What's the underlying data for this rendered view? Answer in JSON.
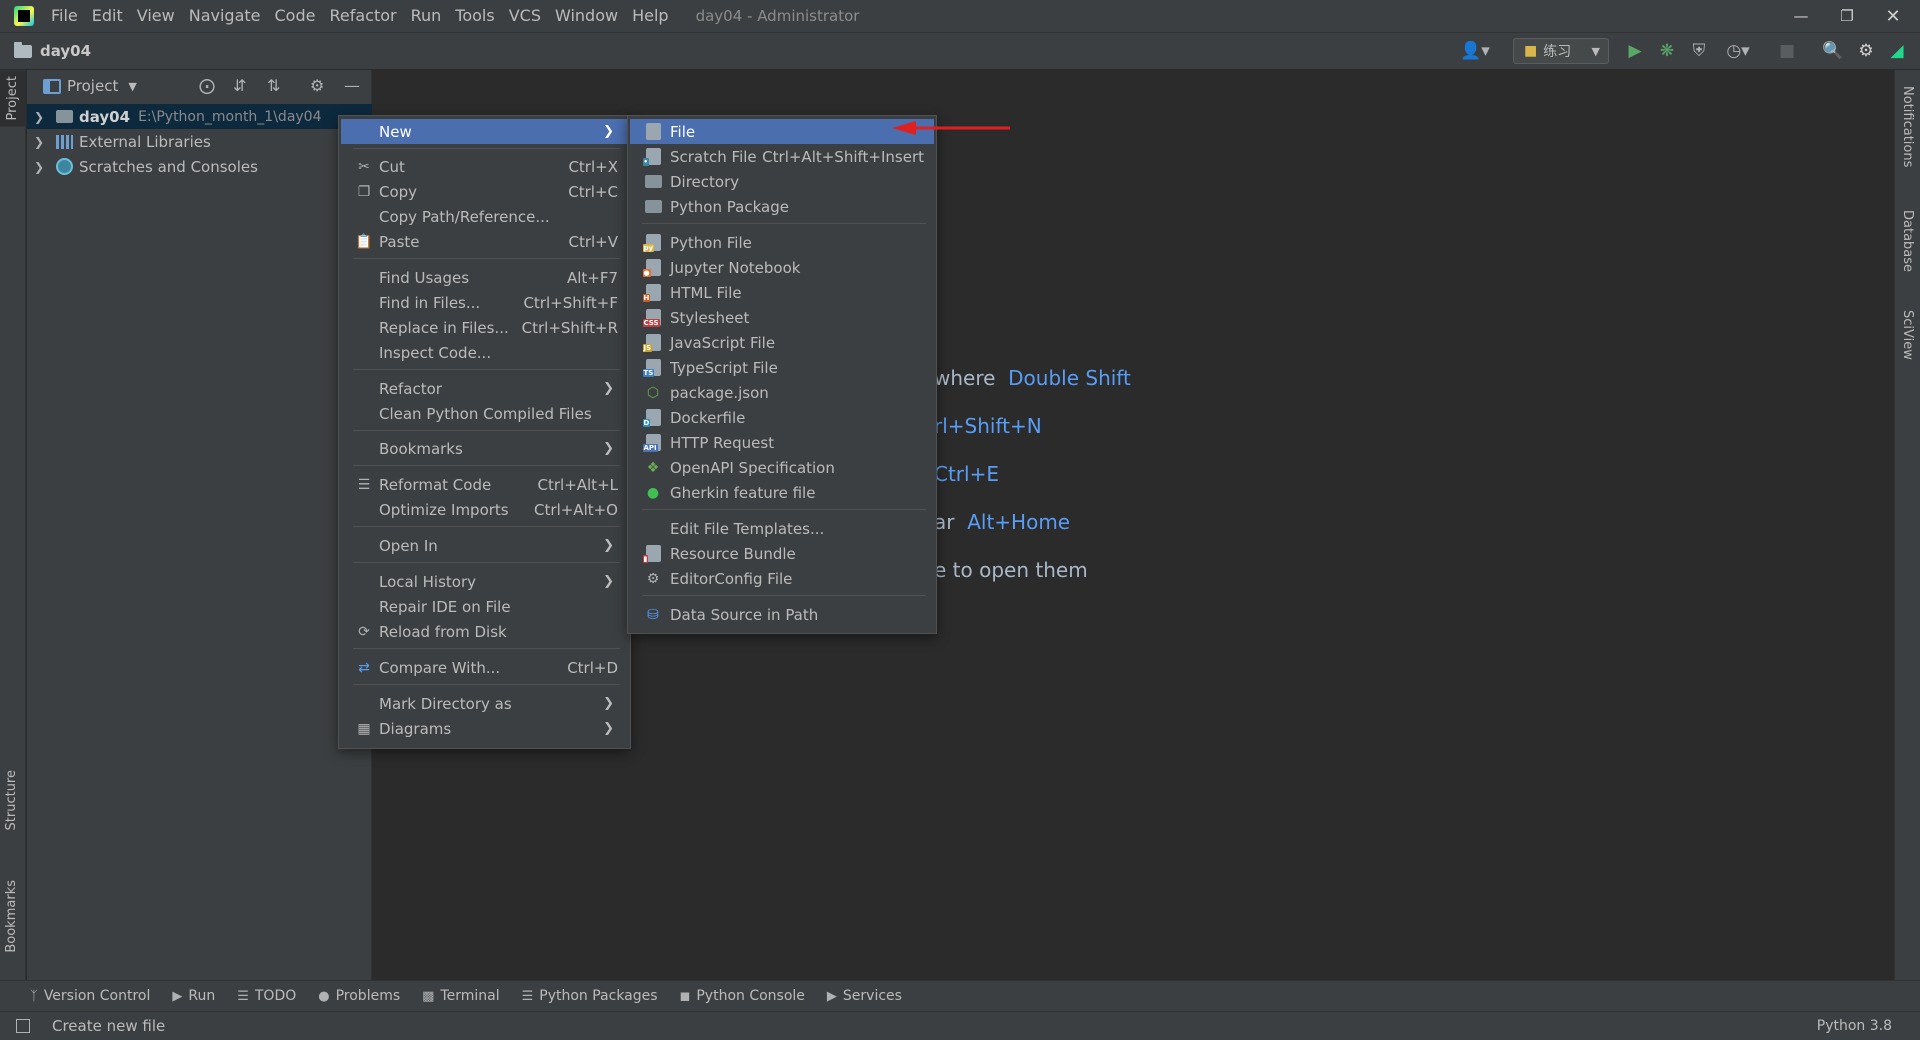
{
  "window": {
    "title": "day04 - Administrator"
  },
  "menu": [
    "File",
    "Edit",
    "View",
    "Navigate",
    "Code",
    "Refactor",
    "Run",
    "Tools",
    "VCS",
    "Window",
    "Help"
  ],
  "navbar": {
    "project_name": "day04",
    "run_config": "练习"
  },
  "left_stripe": {
    "project": "Project",
    "structure": "Structure",
    "bookmarks": "Bookmarks"
  },
  "right_stripe": {
    "notifications": "Notifications",
    "database": "Database",
    "sciview": "SciView"
  },
  "project_panel": {
    "title": "Project",
    "tree": [
      {
        "name": "day04",
        "path": "E:\\Python_month_1\\day04"
      },
      {
        "name": "External Libraries"
      },
      {
        "name": "Scratches and Consoles"
      }
    ]
  },
  "editor_hints": [
    {
      "text": "where",
      "key": "Double Shift"
    },
    {
      "text": "rl+Shift+N"
    },
    {
      "text": "Ctrl+E"
    },
    {
      "text": "ar",
      "key": "Alt+Home"
    },
    {
      "text": "e to open them"
    }
  ],
  "context_menu": {
    "items": [
      {
        "label": "New"
      },
      {
        "label": "Cut",
        "shortcut": "Ctrl+X"
      },
      {
        "label": "Copy",
        "shortcut": "Ctrl+C"
      },
      {
        "label": "Copy Path/Reference..."
      },
      {
        "label": "Paste",
        "shortcut": "Ctrl+V"
      },
      {
        "label": "Find Usages",
        "shortcut": "Alt+F7"
      },
      {
        "label": "Find in Files...",
        "shortcut": "Ctrl+Shift+F"
      },
      {
        "label": "Replace in Files...",
        "shortcut": "Ctrl+Shift+R"
      },
      {
        "label": "Inspect Code..."
      },
      {
        "label": "Refactor"
      },
      {
        "label": "Clean Python Compiled Files"
      },
      {
        "label": "Bookmarks"
      },
      {
        "label": "Reformat Code",
        "shortcut": "Ctrl+Alt+L"
      },
      {
        "label": "Optimize Imports",
        "shortcut": "Ctrl+Alt+O"
      },
      {
        "label": "Open In"
      },
      {
        "label": "Local History"
      },
      {
        "label": "Repair IDE on File"
      },
      {
        "label": "Reload from Disk"
      },
      {
        "label": "Compare With...",
        "shortcut": "Ctrl+D"
      },
      {
        "label": "Mark Directory as"
      },
      {
        "label": "Diagrams"
      }
    ]
  },
  "new_submenu": {
    "items": [
      {
        "label": "File"
      },
      {
        "label": "Scratch File",
        "shortcut": "Ctrl+Alt+Shift+Insert"
      },
      {
        "label": "Directory"
      },
      {
        "label": "Python Package"
      },
      {
        "label": "Python File"
      },
      {
        "label": "Jupyter Notebook"
      },
      {
        "label": "HTML File"
      },
      {
        "label": "Stylesheet"
      },
      {
        "label": "JavaScript File"
      },
      {
        "label": "TypeScript File"
      },
      {
        "label": "package.json"
      },
      {
        "label": "Dockerfile"
      },
      {
        "label": "HTTP Request"
      },
      {
        "label": "OpenAPI Specification"
      },
      {
        "label": "Gherkin feature file"
      },
      {
        "label": "Edit File Templates..."
      },
      {
        "label": "Resource Bundle"
      },
      {
        "label": "EditorConfig File"
      },
      {
        "label": "Data Source in Path"
      }
    ]
  },
  "tool_tabs": [
    "Version Control",
    "Run",
    "TODO",
    "Problems",
    "Terminal",
    "Python Packages",
    "Python Console",
    "Services"
  ],
  "status": {
    "message": "Create new file",
    "interpreter": "Python 3.8"
  },
  "colors": {
    "selection": "#4b6eaf",
    "background": "#2b2b2b",
    "panel": "#3c3f41",
    "accent_arrow": "#e02020",
    "hint_key": "#589df6"
  }
}
